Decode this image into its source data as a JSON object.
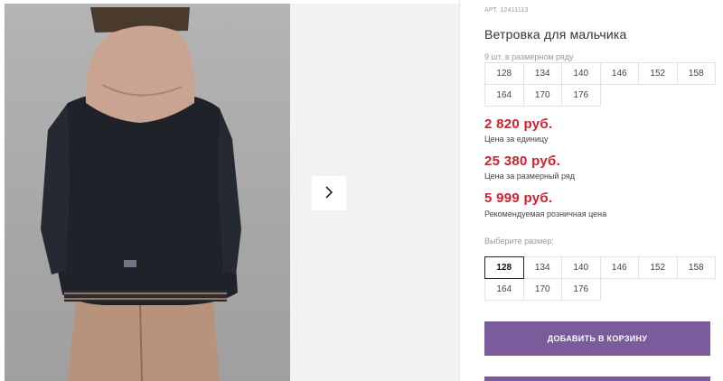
{
  "product": {
    "article_label": "АРТ. 12411113",
    "title": "Ветровка для мальчика",
    "quantity_note": "9 шт. в размерном ряду",
    "size_range": [
      "128",
      "134",
      "140",
      "146",
      "152",
      "158",
      "164",
      "170",
      "176"
    ]
  },
  "prices": [
    {
      "value": "2 820 руб.",
      "label": "Цена за единицу"
    },
    {
      "value": "25 380 руб.",
      "label": "Цена за размерный ряд"
    },
    {
      "value": "5 999 руб.",
      "label": "Рекомендуемая розничная цена"
    }
  ],
  "size_selector": {
    "label": "Выберите размер:",
    "options": [
      "128",
      "134",
      "140",
      "146",
      "152",
      "158",
      "164",
      "170",
      "176"
    ],
    "selected": "128"
  },
  "actions": {
    "add_to_cart": "ДОБАВИТЬ В КОРЗИНУ"
  },
  "gallery": {
    "next_icon": "chevron-right-icon"
  },
  "colors": {
    "accent": "#7a5b9c",
    "price": "#d3202c"
  }
}
